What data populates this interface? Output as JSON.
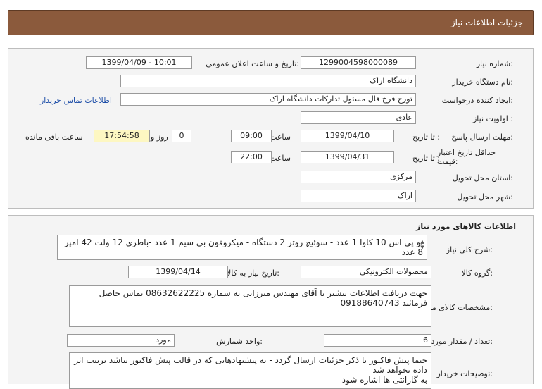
{
  "header": {
    "title": "جزئیات اطلاعات نیاز"
  },
  "need_info": {
    "need_number_label": "شماره نیاز:",
    "need_number": "1299004598000089",
    "announce_label": "تاریخ و ساعت اعلان عمومی:",
    "announce_value": "1399/04/09 - 10:01",
    "buyer_org_label": "نام دستگاه خریدار:",
    "buyer_org": "دانشگاه اراک",
    "creator_label": "ایجاد کننده درخواست:",
    "creator": "تورج فرخ فال مسئول تدارکات دانشگاه اراک",
    "contact_link": "اطلاعات تماس خریدار",
    "priority_label": "اولویت نیاز :",
    "priority": "عادی",
    "deadline_label": "مهلت ارسال پاسخ:",
    "to_date_label": "تا تاریخ :",
    "deadline_date": "1399/04/10",
    "time_label": "ساعت",
    "deadline_time": "09:00",
    "days_value": "0",
    "days_label": "روز و",
    "remaining_time": "17:54:58",
    "remaining_label": "ساعت باقی مانده",
    "validity_label": "حداقل تاریخ اعتبار قیمت:",
    "validity_date": "1399/04/31",
    "validity_time": "22:00",
    "province_label": "استان محل تحویل:",
    "province": "مرکزی",
    "city_label": "شهر محل تحویل:",
    "city": "اراک"
  },
  "goods": {
    "section_title": "اطلاعات کالاهای مورد نیاز",
    "summary_label": "شرح کلی نیاز:",
    "summary": "یو پی اس 10 کاوا  1 عدد - سوئیچ روتر  2 دستگاه - میکروفون بی سیم 1 عدد -باطری 12 ولت 42 امپر 8 عدد",
    "group_label": "گروه کالا:",
    "group": "محصولات الکترونیکی",
    "need_date_label": "تاریخ نیاز به کالا:",
    "need_date": "1399/04/14",
    "specs_label": "مشخصات کالای مورد نیاز:",
    "specs": "جهت دریافت اطلاعات بیشتر با آقای مهندس میرزایی به شماره 08632622225 تماس حاصل فرمائید 09188640743",
    "quantity_label": "تعداد / مقدار مورد نیاز:",
    "quantity": "6",
    "unit_label": "واحد شمارش:",
    "unit": "مورد",
    "buyer_notes_label": "توضیحات خریدار:",
    "buyer_notes": "حتما پیش فاکتور با ذکر جزئیات ارسال گردد - به پیشنهادهایی که در قالب پیش فاکتور نباشد ترتیب اثر داده نخواهد شد\nبه گارانتی ها اشاره شود"
  }
}
